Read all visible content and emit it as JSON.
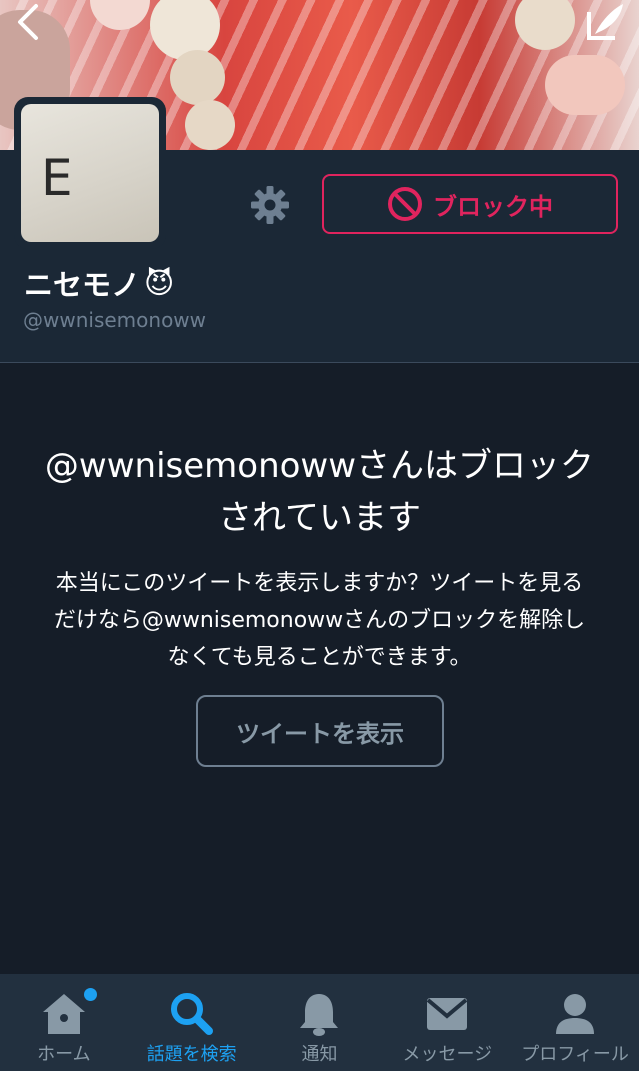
{
  "banner": {
    "alt": "profile-header-photo"
  },
  "profile": {
    "avatar_letter": "E",
    "display_name": "ニセモノ",
    "emoji": "😈",
    "handle": "@wwnisemonoww",
    "block_button_label": "ブロック中"
  },
  "blocked": {
    "title": "@wwnisemonowwさんはブロックされています",
    "description": "本当にこのツイートを表示しますか？ツイートを見るだけなら@wwnisemonowwさんのブロックを解除しなくても見ることができます。",
    "show_tweets_label": "ツイートを表示"
  },
  "tabbar": {
    "items": [
      {
        "label": "ホーム",
        "icon": "home-icon",
        "active": false,
        "badge": true
      },
      {
        "label": "話題を検索",
        "icon": "search-icon",
        "active": true,
        "badge": false
      },
      {
        "label": "通知",
        "icon": "bell-icon",
        "active": false,
        "badge": false
      },
      {
        "label": "メッセージ",
        "icon": "envelope-icon",
        "active": false,
        "badge": false
      },
      {
        "label": "プロフィール",
        "icon": "person-icon",
        "active": false,
        "badge": false
      }
    ]
  },
  "colors": {
    "accent": "#1da1f2",
    "block_red": "#e0245e",
    "background": "#151d28",
    "panel": "#1b2836",
    "muted": "#8899a6"
  }
}
